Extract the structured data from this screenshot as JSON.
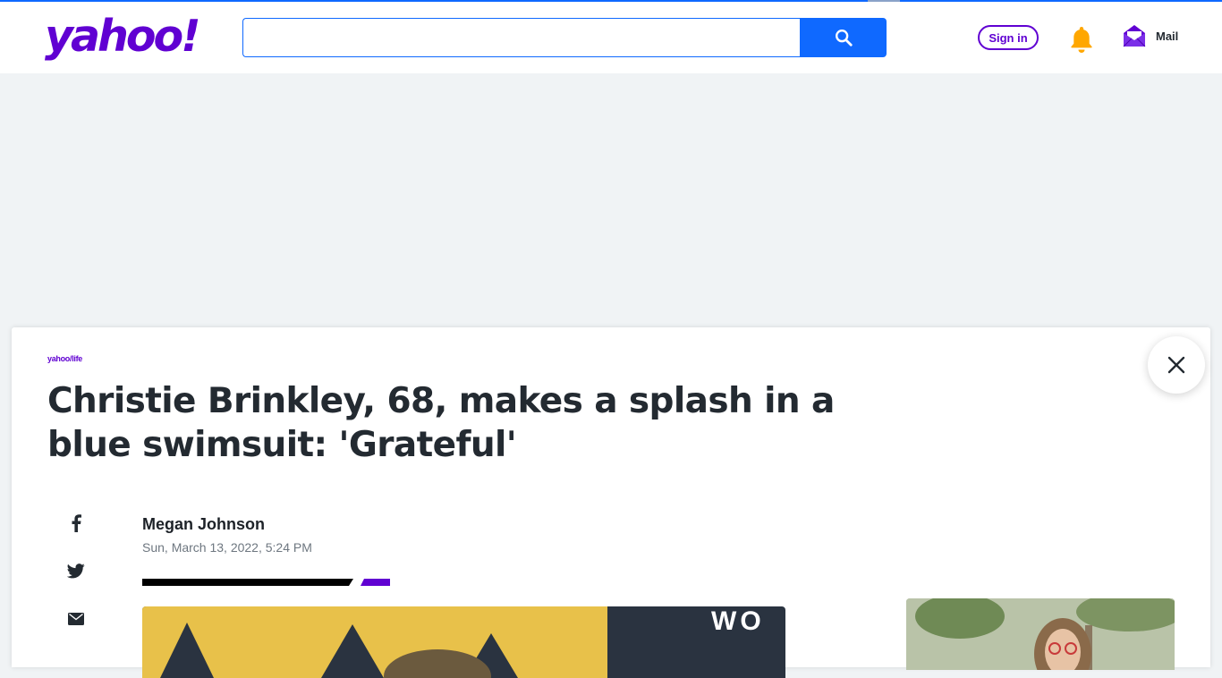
{
  "header": {
    "logo_text": "yahoo!",
    "search": {
      "value": "",
      "placeholder": ""
    },
    "sign_in_label": "Sign in",
    "mail_label": "Mail"
  },
  "icons": {
    "search": "search-icon",
    "bell": "bell-icon",
    "mail": "mail-icon",
    "close": "close-icon",
    "facebook": "facebook-icon",
    "twitter": "twitter-icon",
    "email": "email-icon"
  },
  "colors": {
    "brand": "#6001d2",
    "search_button": "#0f69ff",
    "notification": "#ffa700",
    "headline": "#232a31"
  },
  "article": {
    "brand_label": "yahoo/life",
    "title": "Christie Brinkley, 68, makes a splash in a blue swimsuit: 'Grateful'",
    "author": "Megan Johnson",
    "date": "Sun, March 13, 2022, 5:24 PM",
    "hero_text": "WO"
  }
}
